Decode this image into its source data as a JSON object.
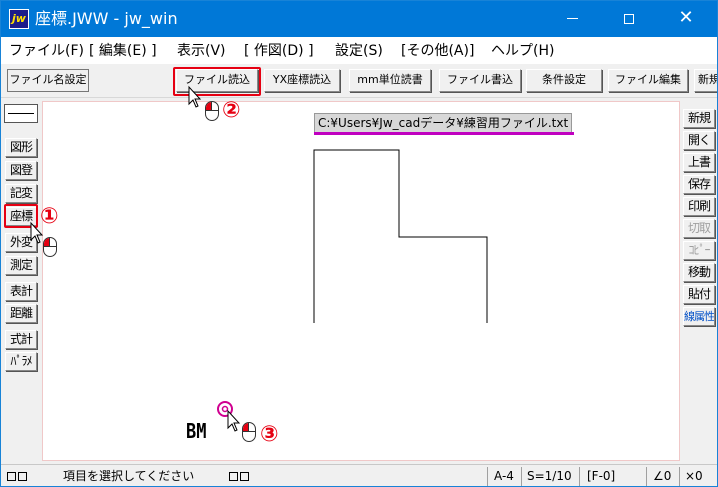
{
  "window": {
    "title": "座標.JWW - jw_win",
    "icon_label": "jw"
  },
  "menu": [
    "ファイル(F)",
    "[ 編集(E) ]",
    "表示(V)",
    "[ 作図(D) ]",
    "設定(S)",
    "[その他(A)]",
    "ヘルプ(H)"
  ],
  "toolbar": {
    "filename_setting": "ファイル名設定",
    "file_read": "ファイル読込",
    "yx_read": "YX座標読込",
    "mm_read": "mm単位読書",
    "file_write": "ファイル書込",
    "condition": "条件設定",
    "file_edit": "ファイル編集",
    "new": "新規"
  },
  "left_tools": [
    "図形",
    "図登",
    "記変",
    "座標",
    "外変",
    "測定",
    "表計",
    "距離",
    "式計",
    "ﾊﾟﾗﾒ"
  ],
  "right_tools": [
    "新規",
    "開く",
    "上書",
    "保存",
    "印刷",
    "切取",
    "ｺﾋﾟｰ",
    "移動",
    "貼付",
    "線属性"
  ],
  "canvas": {
    "file_path": "C:¥Users¥Jw_cadデータ¥練習用ファイル.txt",
    "bm_label": "BM"
  },
  "steps": [
    "①",
    "②",
    "③"
  ],
  "statusbar": {
    "message": "項目を選択してください",
    "paper": "A-4",
    "scale": "S=1/10",
    "layer": "[F-0]",
    "angle": "∠0",
    "zoom": "×0"
  },
  "colors": {
    "titlebar": "#0078d7",
    "highlight": "#e60012",
    "file_underline": "#c000c0"
  }
}
